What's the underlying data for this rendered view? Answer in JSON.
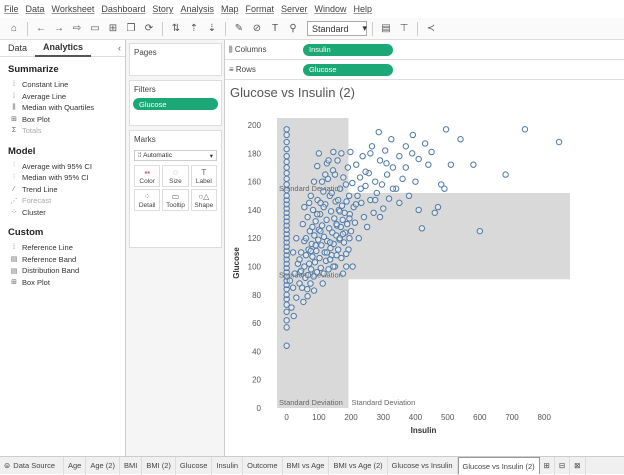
{
  "menu": [
    "File",
    "Data",
    "Worksheet",
    "Dashboard",
    "Story",
    "Analysis",
    "Map",
    "Format",
    "Server",
    "Window",
    "Help"
  ],
  "toolbar": {
    "fit_value": "Standard"
  },
  "left_pane": {
    "tabs": [
      "Data",
      "Analytics"
    ],
    "summarize": {
      "title": "Summarize",
      "items": [
        {
          "label": "Constant Line",
          "icon": "line-icon",
          "disabled": false
        },
        {
          "label": "Average Line",
          "icon": "line-icon",
          "disabled": false
        },
        {
          "label": "Median with Quartiles",
          "icon": "median-icon",
          "disabled": false
        },
        {
          "label": "Box Plot",
          "icon": "boxplot-icon",
          "disabled": false
        },
        {
          "label": "Totals",
          "icon": "totals-icon",
          "disabled": true
        }
      ]
    },
    "model": {
      "title": "Model",
      "items": [
        {
          "label": "Average with 95% CI",
          "icon": "ci-icon",
          "disabled": false
        },
        {
          "label": "Median with 95% CI",
          "icon": "ci-icon",
          "disabled": false
        },
        {
          "label": "Trend Line",
          "icon": "trend-icon",
          "disabled": false
        },
        {
          "label": "Forecast",
          "icon": "forecast-icon",
          "disabled": true
        },
        {
          "label": "Cluster",
          "icon": "cluster-icon",
          "disabled": false
        }
      ]
    },
    "custom": {
      "title": "Custom",
      "items": [
        {
          "label": "Reference Line",
          "icon": "line-icon",
          "disabled": false
        },
        {
          "label": "Reference Band",
          "icon": "band-icon",
          "disabled": false
        },
        {
          "label": "Distribution Band",
          "icon": "band-icon",
          "disabled": false
        },
        {
          "label": "Box Plot",
          "icon": "boxplot-icon",
          "disabled": false
        }
      ]
    }
  },
  "pages": {
    "title": "Pages"
  },
  "filters": {
    "title": "Filters",
    "pill": "Glucose"
  },
  "marks": {
    "title": "Marks",
    "type": "Automatic",
    "buttons": [
      {
        "label": "Color",
        "icon": "color-icon"
      },
      {
        "label": "Size",
        "icon": "size-icon"
      },
      {
        "label": "Label",
        "icon": "label-icon"
      },
      {
        "label": "Detail",
        "icon": "detail-icon"
      },
      {
        "label": "Tooltip",
        "icon": "tooltip-icon"
      },
      {
        "label": "Shape",
        "icon": "shape-icon"
      }
    ]
  },
  "shelves": {
    "columns_label": "Columns",
    "columns_pill": "Insulin",
    "rows_label": "Rows",
    "rows_pill": "Glucose"
  },
  "viz": {
    "title": "Glucose vs Insulin (2)"
  },
  "colors": {
    "accent_green": "#1ba776",
    "mark_stroke": "#4e79a7",
    "band_fill": "#d9d9d9"
  },
  "chart_data": {
    "type": "scatter",
    "title": "Glucose vs Insulin (2)",
    "xlabel": "Insulin",
    "ylabel": "Glucose",
    "xlim": [
      -30,
      880
    ],
    "ylim": [
      0,
      205
    ],
    "x_ticks": [
      0,
      100,
      200,
      300,
      400,
      500,
      600,
      700,
      800
    ],
    "y_ticks": [
      0,
      20,
      40,
      60,
      80,
      100,
      120,
      140,
      160,
      180,
      200
    ],
    "grid": false,
    "reference_bands": [
      {
        "axis": "x",
        "from": -30,
        "to": 192,
        "label_lower": "Standard Deviation",
        "label_upper": "Standard Deviation"
      },
      {
        "axis": "y",
        "from": 91,
        "to": 152,
        "label_lower": "Standard Deviation",
        "label_upper": "Standard Deviation"
      }
    ],
    "points": [
      [
        0,
        44
      ],
      [
        0,
        57
      ],
      [
        0,
        62
      ],
      [
        0,
        68
      ],
      [
        0,
        73
      ],
      [
        0,
        77
      ],
      [
        0,
        80
      ],
      [
        0,
        84
      ],
      [
        0,
        87
      ],
      [
        0,
        90
      ],
      [
        0,
        93
      ],
      [
        0,
        96
      ],
      [
        0,
        99
      ],
      [
        0,
        102
      ],
      [
        0,
        105
      ],
      [
        0,
        108
      ],
      [
        0,
        111
      ],
      [
        0,
        114
      ],
      [
        0,
        117
      ],
      [
        0,
        120
      ],
      [
        0,
        123
      ],
      [
        0,
        126
      ],
      [
        0,
        129
      ],
      [
        0,
        132
      ],
      [
        0,
        135
      ],
      [
        0,
        138
      ],
      [
        0,
        141
      ],
      [
        0,
        144
      ],
      [
        0,
        147
      ],
      [
        0,
        150
      ],
      [
        0,
        154
      ],
      [
        0,
        158
      ],
      [
        0,
        162
      ],
      [
        0,
        166
      ],
      [
        0,
        170
      ],
      [
        0,
        174
      ],
      [
        0,
        178
      ],
      [
        0,
        183
      ],
      [
        0,
        188
      ],
      [
        0,
        193
      ],
      [
        0,
        197
      ],
      [
        15,
        71
      ],
      [
        22,
        65
      ],
      [
        30,
        78
      ],
      [
        40,
        88
      ],
      [
        42,
        96
      ],
      [
        48,
        85
      ],
      [
        52,
        75
      ],
      [
        55,
        100
      ],
      [
        58,
        92
      ],
      [
        60,
        108
      ],
      [
        64,
        84
      ],
      [
        66,
        94
      ],
      [
        68,
        112
      ],
      [
        70,
        102
      ],
      [
        72,
        125
      ],
      [
        74,
        88
      ],
      [
        76,
        98
      ],
      [
        78,
        116
      ],
      [
        80,
        107
      ],
      [
        82,
        140
      ],
      [
        84,
        93
      ],
      [
        86,
        122
      ],
      [
        88,
        103
      ],
      [
        90,
        132
      ],
      [
        92,
        111
      ],
      [
        94,
        96
      ],
      [
        96,
        147
      ],
      [
        98,
        119
      ],
      [
        100,
        126
      ],
      [
        102,
        106
      ],
      [
        104,
        137
      ],
      [
        106,
        99
      ],
      [
        108,
        115
      ],
      [
        110,
        129
      ],
      [
        112,
        88
      ],
      [
        114,
        153
      ],
      [
        116,
        121
      ],
      [
        118,
        110
      ],
      [
        120,
        144
      ],
      [
        122,
        104
      ],
      [
        124,
        133
      ],
      [
        126,
        118
      ],
      [
        128,
        162
      ],
      [
        130,
        98
      ],
      [
        132,
        127
      ],
      [
        134,
        150
      ],
      [
        136,
        113
      ],
      [
        138,
        139
      ],
      [
        140,
        108
      ],
      [
        142,
        124
      ],
      [
        144,
        168
      ],
      [
        146,
        116
      ],
      [
        148,
        134
      ],
      [
        150,
        100
      ],
      [
        152,
        146
      ],
      [
        154,
        122
      ],
      [
        156,
        129
      ],
      [
        158,
        175
      ],
      [
        160,
        112
      ],
      [
        162,
        140
      ],
      [
        164,
        119
      ],
      [
        166,
        155
      ],
      [
        168,
        128
      ],
      [
        170,
        106
      ],
      [
        172,
        143
      ],
      [
        174,
        133
      ],
      [
        176,
        163
      ],
      [
        178,
        117
      ],
      [
        180,
        138
      ],
      [
        182,
        124
      ],
      [
        184,
        158
      ],
      [
        186,
        146
      ],
      [
        188,
        130
      ],
      [
        190,
        170
      ],
      [
        192,
        112
      ],
      [
        194,
        150
      ],
      [
        196,
        137
      ],
      [
        198,
        181
      ],
      [
        200,
        125
      ],
      [
        204,
        159
      ],
      [
        208,
        142
      ],
      [
        212,
        131
      ],
      [
        216,
        172
      ],
      [
        220,
        150
      ],
      [
        224,
        120
      ],
      [
        228,
        163
      ],
      [
        232,
        145
      ],
      [
        236,
        178
      ],
      [
        240,
        135
      ],
      [
        245,
        157
      ],
      [
        250,
        128
      ],
      [
        255,
        166
      ],
      [
        260,
        147
      ],
      [
        265,
        185
      ],
      [
        270,
        138
      ],
      [
        275,
        160
      ],
      [
        280,
        152
      ],
      [
        286,
        195
      ],
      [
        290,
        175
      ],
      [
        296,
        158
      ],
      [
        300,
        141
      ],
      [
        306,
        182
      ],
      [
        312,
        165
      ],
      [
        318,
        148
      ],
      [
        325,
        190
      ],
      [
        330,
        170
      ],
      [
        340,
        155
      ],
      [
        350,
        178
      ],
      [
        360,
        162
      ],
      [
        370,
        185
      ],
      [
        380,
        150
      ],
      [
        392,
        193
      ],
      [
        400,
        160
      ],
      [
        410,
        176
      ],
      [
        420,
        127
      ],
      [
        430,
        187
      ],
      [
        440,
        172
      ],
      [
        450,
        181
      ],
      [
        460,
        138
      ],
      [
        470,
        142
      ],
      [
        480,
        158
      ],
      [
        490,
        155
      ],
      [
        495,
        197
      ],
      [
        510,
        172
      ],
      [
        540,
        190
      ],
      [
        580,
        172
      ],
      [
        600,
        125
      ],
      [
        680,
        165
      ],
      [
        740,
        197
      ],
      [
        846,
        188
      ],
      [
        10,
        90
      ],
      [
        20,
        85
      ],
      [
        25,
        95
      ],
      [
        35,
        102
      ],
      [
        45,
        110
      ],
      [
        55,
        118
      ],
      [
        65,
        135
      ],
      [
        75,
        150
      ],
      [
        85,
        160
      ],
      [
        95,
        171
      ],
      [
        105,
        145
      ],
      [
        115,
        95
      ],
      [
        125,
        173
      ],
      [
        135,
        105
      ],
      [
        145,
        181
      ],
      [
        155,
        130
      ],
      [
        165,
        139
      ],
      [
        175,
        95
      ],
      [
        185,
        100
      ],
      [
        195,
        120
      ],
      [
        170,
        180
      ],
      [
        160,
        147
      ],
      [
        150,
        165
      ],
      [
        140,
        152
      ],
      [
        130,
        175
      ],
      [
        120,
        165
      ],
      [
        110,
        160
      ],
      [
        100,
        180
      ],
      [
        90,
        115
      ],
      [
        80,
        128
      ],
      [
        70,
        145
      ],
      [
        60,
        120
      ],
      [
        50,
        130
      ],
      [
        40,
        105
      ],
      [
        30,
        120
      ],
      [
        20,
        110
      ],
      [
        45,
        97
      ],
      [
        55,
        142
      ],
      [
        65,
        79
      ],
      [
        75,
        111
      ],
      [
        85,
        83
      ],
      [
        95,
        137
      ],
      [
        105,
        125
      ],
      [
        115,
        142
      ],
      [
        125,
        110
      ],
      [
        135,
        117
      ],
      [
        145,
        100
      ],
      [
        155,
        108
      ],
      [
        165,
        120
      ],
      [
        175,
        123
      ],
      [
        185,
        109
      ],
      [
        195,
        134
      ],
      [
        205,
        100
      ],
      [
        215,
        144
      ],
      [
        230,
        155
      ],
      [
        245,
        167
      ],
      [
        260,
        180
      ],
      [
        275,
        147
      ],
      [
        290,
        135
      ],
      [
        310,
        173
      ],
      [
        330,
        155
      ],
      [
        350,
        145
      ],
      [
        370,
        170
      ],
      [
        390,
        180
      ],
      [
        410,
        140
      ]
    ]
  },
  "bottom_tabs": [
    "Data Source",
    "Age",
    "Age (2)",
    "BMI",
    "BMI (2)",
    "Glucose",
    "Insulin",
    "Outcome",
    "BMI vs Age",
    "BMI vs Age (2)",
    "Glucose vs Insulin",
    "Glucose vs Insulin (2)"
  ],
  "active_tab": "Glucose vs Insulin (2)"
}
